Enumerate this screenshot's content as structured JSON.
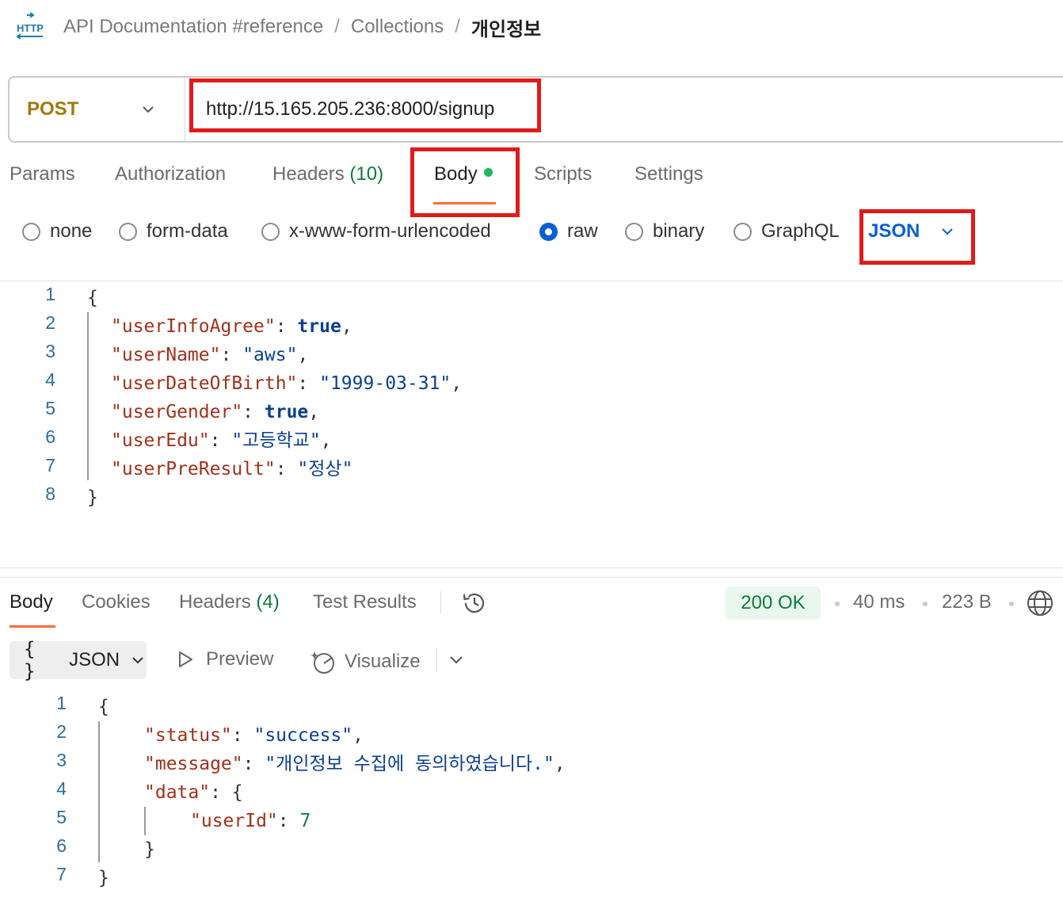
{
  "breadcrumb": {
    "items": [
      "API Documentation #reference",
      "Collections"
    ],
    "separator": "/",
    "current": "개인정보"
  },
  "request": {
    "method": "POST",
    "url": "http://15.165.205.236:8000/signup"
  },
  "request_tabs": [
    {
      "label": "Params",
      "count": ""
    },
    {
      "label": "Authorization",
      "count": ""
    },
    {
      "label": "Headers",
      "count": "(10)"
    },
    {
      "label": "Body",
      "count": ""
    },
    {
      "label": "Scripts",
      "count": ""
    },
    {
      "label": "Settings",
      "count": ""
    }
  ],
  "body_types": [
    {
      "label": "none",
      "selected": false
    },
    {
      "label": "form-data",
      "selected": false
    },
    {
      "label": "x-www-form-urlencoded",
      "selected": false
    },
    {
      "label": "raw",
      "selected": true
    },
    {
      "label": "binary",
      "selected": false
    },
    {
      "label": "GraphQL",
      "selected": false
    }
  ],
  "raw_format": "JSON",
  "request_body": {
    "line_numbers": [
      "1",
      "2",
      "3",
      "4",
      "5",
      "6",
      "7",
      "8"
    ],
    "open": "{",
    "close": "}",
    "fields": [
      {
        "key": "\"userInfoAgree\"",
        "value": "true",
        "comma": ","
      },
      {
        "key": "\"userName\"",
        "value": "\"aws\"",
        "comma": ","
      },
      {
        "key": "\"userDateOfBirth\"",
        "value": "\"1999-03-31\"",
        "comma": ","
      },
      {
        "key": "\"userGender\"",
        "value": "true",
        "comma": ","
      },
      {
        "key": "\"userEdu\"",
        "value": "\"고등학교\"",
        "comma": ","
      },
      {
        "key": "\"userPreResult\"",
        "value": "\"정상\"",
        "comma": ""
      }
    ]
  },
  "response_tabs": [
    {
      "label": "Body",
      "count": ""
    },
    {
      "label": "Cookies",
      "count": ""
    },
    {
      "label": "Headers",
      "count": "(4)"
    },
    {
      "label": "Test Results",
      "count": ""
    }
  ],
  "response_meta": {
    "status": "200 OK",
    "time": "40 ms",
    "size": "223 B"
  },
  "response_view": {
    "format": "JSON",
    "preview": "Preview",
    "visualize": "Visualize"
  },
  "response_body": {
    "line_numbers": [
      "1",
      "2",
      "3",
      "4",
      "5",
      "6",
      "7"
    ],
    "open": "{",
    "close": "}",
    "status_key": "\"status\"",
    "status_value": "\"success\"",
    "message_key": "\"message\"",
    "message_value": "\"개인정보 수집에 동의하였습니다.\"",
    "data_key": "\"data\"",
    "userid_key": "\"userId\"",
    "userid_value": "7"
  },
  "colors": {
    "method": "#a2790d",
    "highlight": "#e01b1b",
    "accent_tab": "#ff6c37",
    "status_ok": "#0d7a3b",
    "link_blue": "#0b5fd6"
  }
}
